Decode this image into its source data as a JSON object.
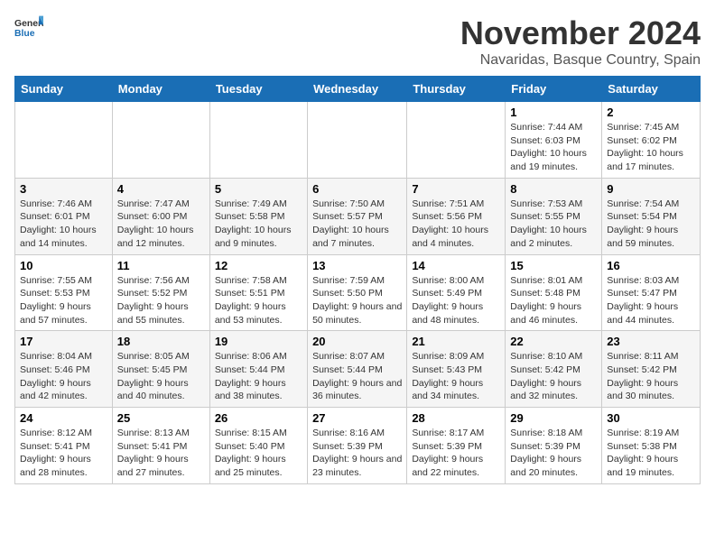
{
  "logo": {
    "text_general": "General",
    "text_blue": "Blue",
    "icon_label": "general-blue-logo-icon"
  },
  "header": {
    "month_year": "November 2024",
    "location": "Navaridas, Basque Country, Spain"
  },
  "weekdays": [
    "Sunday",
    "Monday",
    "Tuesday",
    "Wednesday",
    "Thursday",
    "Friday",
    "Saturday"
  ],
  "weeks": [
    {
      "days": [
        {
          "num": "",
          "info": ""
        },
        {
          "num": "",
          "info": ""
        },
        {
          "num": "",
          "info": ""
        },
        {
          "num": "",
          "info": ""
        },
        {
          "num": "",
          "info": ""
        },
        {
          "num": "1",
          "info": "Sunrise: 7:44 AM\nSunset: 6:03 PM\nDaylight: 10 hours and 19 minutes."
        },
        {
          "num": "2",
          "info": "Sunrise: 7:45 AM\nSunset: 6:02 PM\nDaylight: 10 hours and 17 minutes."
        }
      ]
    },
    {
      "days": [
        {
          "num": "3",
          "info": "Sunrise: 7:46 AM\nSunset: 6:01 PM\nDaylight: 10 hours and 14 minutes."
        },
        {
          "num": "4",
          "info": "Sunrise: 7:47 AM\nSunset: 6:00 PM\nDaylight: 10 hours and 12 minutes."
        },
        {
          "num": "5",
          "info": "Sunrise: 7:49 AM\nSunset: 5:58 PM\nDaylight: 10 hours and 9 minutes."
        },
        {
          "num": "6",
          "info": "Sunrise: 7:50 AM\nSunset: 5:57 PM\nDaylight: 10 hours and 7 minutes."
        },
        {
          "num": "7",
          "info": "Sunrise: 7:51 AM\nSunset: 5:56 PM\nDaylight: 10 hours and 4 minutes."
        },
        {
          "num": "8",
          "info": "Sunrise: 7:53 AM\nSunset: 5:55 PM\nDaylight: 10 hours and 2 minutes."
        },
        {
          "num": "9",
          "info": "Sunrise: 7:54 AM\nSunset: 5:54 PM\nDaylight: 9 hours and 59 minutes."
        }
      ]
    },
    {
      "days": [
        {
          "num": "10",
          "info": "Sunrise: 7:55 AM\nSunset: 5:53 PM\nDaylight: 9 hours and 57 minutes."
        },
        {
          "num": "11",
          "info": "Sunrise: 7:56 AM\nSunset: 5:52 PM\nDaylight: 9 hours and 55 minutes."
        },
        {
          "num": "12",
          "info": "Sunrise: 7:58 AM\nSunset: 5:51 PM\nDaylight: 9 hours and 53 minutes."
        },
        {
          "num": "13",
          "info": "Sunrise: 7:59 AM\nSunset: 5:50 PM\nDaylight: 9 hours and 50 minutes."
        },
        {
          "num": "14",
          "info": "Sunrise: 8:00 AM\nSunset: 5:49 PM\nDaylight: 9 hours and 48 minutes."
        },
        {
          "num": "15",
          "info": "Sunrise: 8:01 AM\nSunset: 5:48 PM\nDaylight: 9 hours and 46 minutes."
        },
        {
          "num": "16",
          "info": "Sunrise: 8:03 AM\nSunset: 5:47 PM\nDaylight: 9 hours and 44 minutes."
        }
      ]
    },
    {
      "days": [
        {
          "num": "17",
          "info": "Sunrise: 8:04 AM\nSunset: 5:46 PM\nDaylight: 9 hours and 42 minutes."
        },
        {
          "num": "18",
          "info": "Sunrise: 8:05 AM\nSunset: 5:45 PM\nDaylight: 9 hours and 40 minutes."
        },
        {
          "num": "19",
          "info": "Sunrise: 8:06 AM\nSunset: 5:44 PM\nDaylight: 9 hours and 38 minutes."
        },
        {
          "num": "20",
          "info": "Sunrise: 8:07 AM\nSunset: 5:44 PM\nDaylight: 9 hours and 36 minutes."
        },
        {
          "num": "21",
          "info": "Sunrise: 8:09 AM\nSunset: 5:43 PM\nDaylight: 9 hours and 34 minutes."
        },
        {
          "num": "22",
          "info": "Sunrise: 8:10 AM\nSunset: 5:42 PM\nDaylight: 9 hours and 32 minutes."
        },
        {
          "num": "23",
          "info": "Sunrise: 8:11 AM\nSunset: 5:42 PM\nDaylight: 9 hours and 30 minutes."
        }
      ]
    },
    {
      "days": [
        {
          "num": "24",
          "info": "Sunrise: 8:12 AM\nSunset: 5:41 PM\nDaylight: 9 hours and 28 minutes."
        },
        {
          "num": "25",
          "info": "Sunrise: 8:13 AM\nSunset: 5:41 PM\nDaylight: 9 hours and 27 minutes."
        },
        {
          "num": "26",
          "info": "Sunrise: 8:15 AM\nSunset: 5:40 PM\nDaylight: 9 hours and 25 minutes."
        },
        {
          "num": "27",
          "info": "Sunrise: 8:16 AM\nSunset: 5:39 PM\nDaylight: 9 hours and 23 minutes."
        },
        {
          "num": "28",
          "info": "Sunrise: 8:17 AM\nSunset: 5:39 PM\nDaylight: 9 hours and 22 minutes."
        },
        {
          "num": "29",
          "info": "Sunrise: 8:18 AM\nSunset: 5:39 PM\nDaylight: 9 hours and 20 minutes."
        },
        {
          "num": "30",
          "info": "Sunrise: 8:19 AM\nSunset: 5:38 PM\nDaylight: 9 hours and 19 minutes."
        }
      ]
    }
  ]
}
